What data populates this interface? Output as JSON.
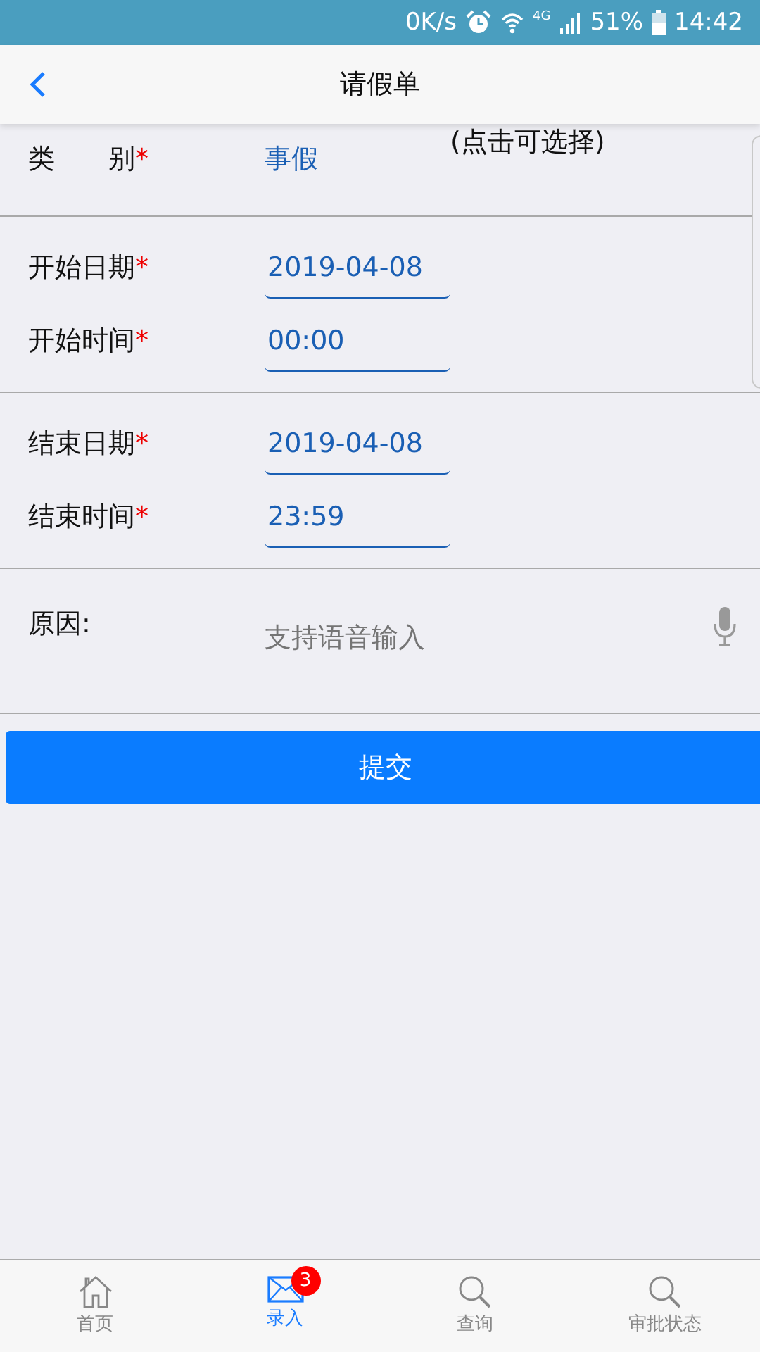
{
  "status_bar": {
    "speed": "0K/s",
    "network": "4G",
    "battery": "51%",
    "time": "14:42"
  },
  "nav": {
    "title": "请假单"
  },
  "sections": [
    {
      "rows": [
        {
          "kind": "select",
          "label": "类　　别",
          "mark": "*",
          "value": "事假",
          "hint": "(点击可选择)"
        }
      ]
    },
    {
      "rows": [
        {
          "kind": "date",
          "label": "开始日期",
          "mark": "*",
          "value": "2019-04-08"
        },
        {
          "kind": "date",
          "label": "开始时间",
          "mark": "*",
          "value": "00:00"
        }
      ]
    },
    {
      "rows": [
        {
          "kind": "date",
          "label": "结束日期",
          "mark": "*",
          "value": "2019-04-08"
        },
        {
          "kind": "date",
          "label": "结束时间",
          "mark": "*",
          "value": "23:59"
        }
      ]
    },
    {
      "rows": [
        {
          "kind": "text",
          "label": "原因:",
          "placeholder": "支持语音输入"
        }
      ]
    }
  ],
  "submit": "提交",
  "tabs": [
    {
      "label": "首页",
      "kind": "home",
      "selected": false
    },
    {
      "label": "录入",
      "kind": "mail",
      "selected": true,
      "badge": "3"
    },
    {
      "label": "查询",
      "kind": "search",
      "selected": false
    },
    {
      "label": "审批状态",
      "kind": "search",
      "selected": false
    }
  ]
}
